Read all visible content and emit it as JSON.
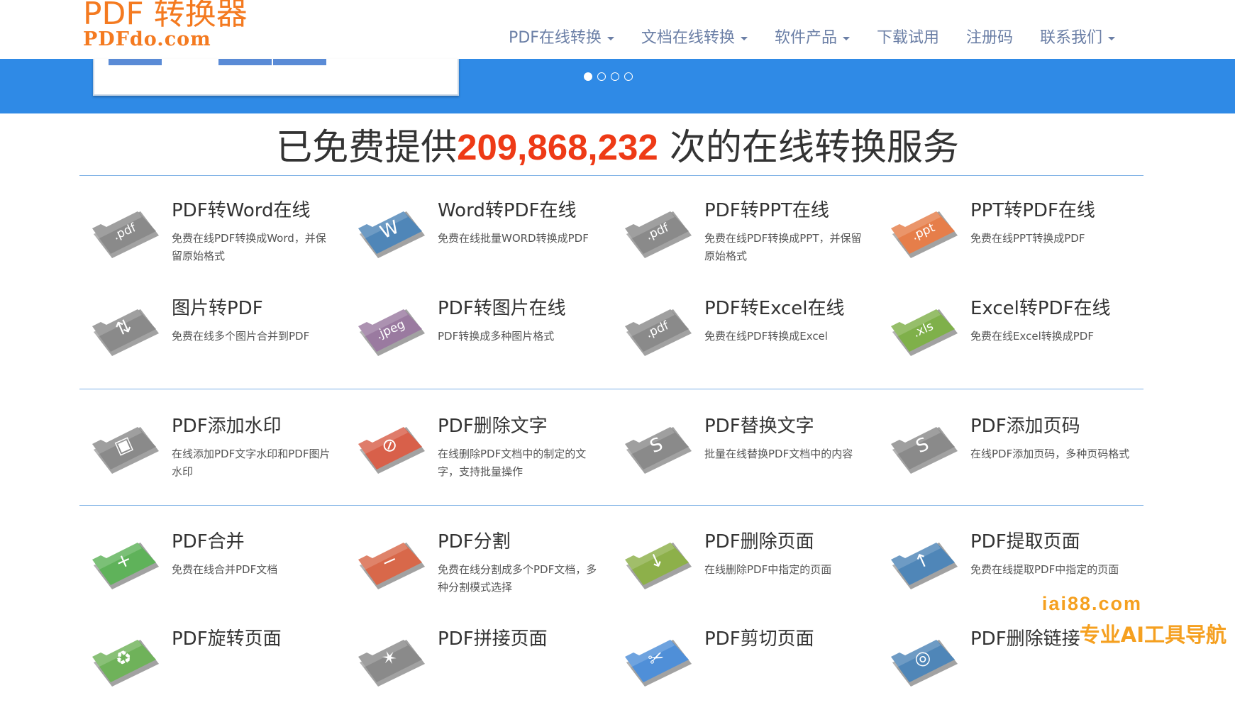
{
  "header": {
    "logo_main": "PDF 转换器",
    "logo_sub": "PDFdo.com",
    "nav": [
      {
        "label": "PDF在线转换",
        "dropdown": true
      },
      {
        "label": "文档在线转换",
        "dropdown": true
      },
      {
        "label": "软件产品",
        "dropdown": true
      },
      {
        "label": "下载试用",
        "dropdown": false
      },
      {
        "label": "注册码",
        "dropdown": false
      },
      {
        "label": "联系我们",
        "dropdown": true
      }
    ]
  },
  "banner": {
    "dots": 4,
    "active_dot": 0,
    "color": "#2f8ae6"
  },
  "counter": {
    "prefix": "已免费提供",
    "number": "209,868,232",
    "suffix": " 次的在线转换服务"
  },
  "tools": [
    {
      "title": "PDF转Word在线",
      "desc": "免费在线PDF转换成Word，并保留原始格式",
      "icon": "pdf-folder-icon",
      "color": "#8a8a8a",
      "label": ".pdf"
    },
    {
      "title": "Word转PDF在线",
      "desc": "免费在线批量WORD转换成PDF",
      "icon": "word-folder-icon",
      "color": "#4f86b8",
      "label": "W"
    },
    {
      "title": "PDF转PPT在线",
      "desc": "免费在线PDF转换成PPT，并保留原始格式",
      "icon": "pdf-folder-icon",
      "color": "#8a8a8a",
      "label": ".pdf"
    },
    {
      "title": "PPT转PDF在线",
      "desc": "免费在线PPT转换成PDF",
      "icon": "ppt-folder-icon",
      "color": "#e67e4a",
      "label": ".ppt"
    },
    {
      "title": "图片转PDF",
      "desc": "免费在线多个图片合并到PDF",
      "icon": "image-folder-icon",
      "color": "#8a8a8a",
      "label": "⇅"
    },
    {
      "title": "PDF转图片在线",
      "desc": "PDF转换成多种图片格式",
      "icon": "jpeg-folder-icon",
      "color": "#9a7aa0",
      "label": ".jpeg"
    },
    {
      "title": "PDF转Excel在线",
      "desc": "免费在线PDF转换成Excel",
      "icon": "pdf-folder-icon",
      "color": "#8a8a8a",
      "label": ".pdf"
    },
    {
      "title": "Excel转PDF在线",
      "desc": "免费在线Excel转换成PDF",
      "icon": "xls-folder-icon",
      "color": "#7fb04a",
      "label": ".xls"
    },
    {
      "title": "PDF添加水印",
      "desc": "在线添加PDF文字水印和PDF图片水印",
      "icon": "watermark-folder-icon",
      "color": "#8a8a8a",
      "label": "▣"
    },
    {
      "title": "PDF删除文字",
      "desc": "在线删除PDF文档中的制定的文字，支持批量操作",
      "icon": "delete-text-folder-icon",
      "color": "#d8604a",
      "label": "⊘"
    },
    {
      "title": "PDF替换文字",
      "desc": "批量在线替换PDF文档中的内容",
      "icon": "replace-text-folder-icon",
      "color": "#8a8a8a",
      "label": "S"
    },
    {
      "title": "PDF添加页码",
      "desc": "在线PDF添加页码，多种页码格式",
      "icon": "page-number-folder-icon",
      "color": "#8a8a8a",
      "label": "S"
    },
    {
      "title": "PDF合并",
      "desc": "免费在线合并PDF文档",
      "icon": "merge-folder-icon",
      "color": "#5fb25a",
      "label": "+"
    },
    {
      "title": "PDF分割",
      "desc": "免费在线分割成多个PDF文档，多种分割模式选择",
      "icon": "split-folder-icon",
      "color": "#d8684a",
      "label": "−"
    },
    {
      "title": "PDF删除页面",
      "desc": "在线删除PDF中指定的页面",
      "icon": "delete-page-folder-icon",
      "color": "#8db04a",
      "label": "↓"
    },
    {
      "title": "PDF提取页面",
      "desc": "免费在线提取PDF中指定的页面",
      "icon": "extract-page-folder-icon",
      "color": "#4f86b8",
      "label": "↑"
    },
    {
      "title": "PDF旋转页面",
      "desc": "",
      "icon": "rotate-folder-icon",
      "color": "#6fb25a",
      "label": "♻"
    },
    {
      "title": "PDF拼接页面",
      "desc": "",
      "icon": "join-folder-icon",
      "color": "#8a8a8a",
      "label": "✶"
    },
    {
      "title": "PDF剪切页面",
      "desc": "",
      "icon": "cut-page-icon",
      "color": "#4f8fd8",
      "label": "✂"
    },
    {
      "title": "PDF删除链接",
      "desc": "",
      "icon": "delete-link-folder-icon",
      "color": "#4f86b8",
      "label": "◎"
    }
  ],
  "watermark": {
    "line1": "iai88.com",
    "line2": "专业AI工具导航"
  }
}
